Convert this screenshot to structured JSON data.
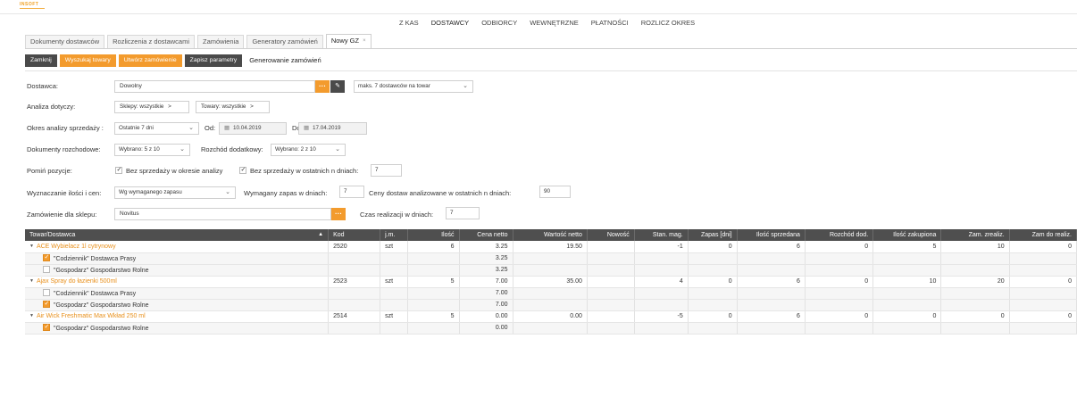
{
  "app": {
    "logo": "INSOFT"
  },
  "mainnav": [
    "Z KAS",
    "DOSTAWCY",
    "ODBIORCY",
    "WEWNĘTRZNE",
    "PŁATNOŚCI",
    "ROZLICZ OKRES"
  ],
  "tabs": [
    "Dokumenty dostawców",
    "Rozliczenia z dostawcami",
    "Zamówienia",
    "Generatory zamówień",
    "Nowy GZ"
  ],
  "tab_close": "×",
  "toolbar": {
    "close": "Zamknij",
    "search": "Wyszukaj towary",
    "create": "Utwórz zamówienie",
    "save": "Zapisz parametry",
    "title": "Generowanie zamówień"
  },
  "form": {
    "supplier_label": "Dostawca:",
    "supplier_value": "Dowolny",
    "supplier_max": "maks. 7 dostawców na towar",
    "analysis_label": "Analiza dotyczy:",
    "shops_chip": "Sklepy: wszystkie",
    "goods_chip": "Towary: wszystkie",
    "period_label": "Okres analizy sprzedaży :",
    "period_value": "Ostatnie 7 dni",
    "from_label": "Od:",
    "from_date": "10.04.2019",
    "to_label": "Do:",
    "to_date": "17.04.2019",
    "docs_label": "Dokumenty rozchodowe:",
    "docs_value": "Wybrano: 5 z 10",
    "extra_label": "Rozchód dodatkowy:",
    "extra_value": "Wybrano: 2 z 10",
    "skip_label": "Pomiń pozycje:",
    "skip_no_sales_period": "Bez sprzedaży w okresie analizy",
    "skip_no_sales_days": "Bez sprzedaży w ostatnich n dniach:",
    "skip_days_value": "7",
    "qty_label": "Wyznaczanie ilości i cen:",
    "qty_value": "Wg wymaganego zapasu",
    "stock_label": "Wymagany zapas w dniach:",
    "stock_value": "7",
    "prices_label": "Ceny dostaw analizowane w ostatnich n dniach:",
    "prices_value": "90",
    "shop_order_label": "Zamówienie dla sklepu:",
    "shop_order_value": "Novitus",
    "lead_label": "Czas realizacji w dniach:",
    "lead_value": "7"
  },
  "table": {
    "headers": [
      "Towar/Dostawca",
      "Kod",
      "j.m.",
      "Ilość",
      "Cena netto",
      "Wartość netto",
      "Nowość",
      "Stan. mag.",
      "Zapas [dni]",
      "Ilość sprzedana",
      "Rozchód dod.",
      "Ilość zakupiona",
      "Zam. zrealiz.",
      "Zam do realiz."
    ],
    "groups": [
      {
        "name": "ACE Wybielacz 1l cytrynowy",
        "code": "2520",
        "unit": "szt",
        "qty": "6",
        "price": "3.25",
        "value": "19.50",
        "new": "",
        "stock": "-1",
        "reserve": "0",
        "sold": "6",
        "extra": "0",
        "bought": "5",
        "done": "10",
        "todo": "0",
        "suppliers": [
          {
            "checked": true,
            "name": "\"Codziennik\" Dostawca Prasy",
            "price": "3.25"
          },
          {
            "checked": false,
            "name": "\"Gospodarz\" Gospodarstwo Rolne",
            "price": "3.25"
          }
        ]
      },
      {
        "name": "Ajax Spray do łazienki 500ml",
        "code": "2523",
        "unit": "szt",
        "qty": "5",
        "price": "7.00",
        "value": "35.00",
        "new": "",
        "stock": "4",
        "reserve": "0",
        "sold": "6",
        "extra": "0",
        "bought": "10",
        "done": "20",
        "todo": "0",
        "suppliers": [
          {
            "checked": false,
            "name": "\"Codziennik\" Dostawca Prasy",
            "price": "7.00"
          },
          {
            "checked": true,
            "name": "\"Gospodarz\" Gospodarstwo Rolne",
            "price": "7.00"
          }
        ]
      },
      {
        "name": "Air Wick Freshmatic Max Wkład 250 ml",
        "code": "2514",
        "unit": "szt",
        "qty": "5",
        "price": "0.00",
        "value": "0.00",
        "new": "",
        "stock": "-5",
        "reserve": "0",
        "sold": "6",
        "extra": "0",
        "bought": "0",
        "done": "0",
        "todo": "0",
        "suppliers": [
          {
            "checked": true,
            "name": "\"Gospodarz\" Gospodarstwo Rolne",
            "price": "0.00"
          }
        ]
      }
    ]
  },
  "colors": {
    "accent": "#f39b2d",
    "dark": "#4a4a4a",
    "header": "#4f4f4f"
  }
}
